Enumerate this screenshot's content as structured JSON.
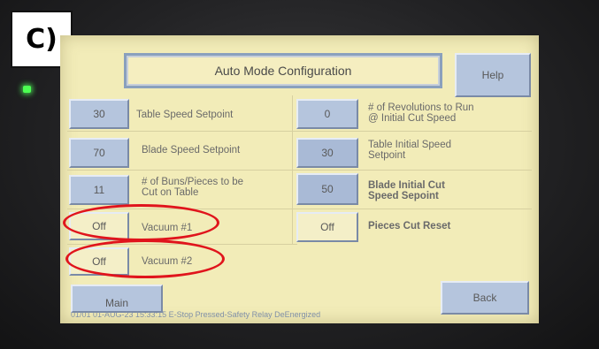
{
  "figure_label": "C)",
  "screen": {
    "title": "Auto Mode Configuration",
    "help_label": "Help",
    "left_rows": [
      {
        "value": "30",
        "label": "Table Speed Setpoint"
      },
      {
        "value": "70",
        "label": "Blade Speed Setpoint"
      },
      {
        "value": "11",
        "label_line1": "# of Buns/Pieces to be",
        "label_line2": "Cut on Table"
      },
      {
        "value": "Off",
        "label": "Vacuum #1"
      },
      {
        "value": "Off",
        "label": "Vacuum #2"
      }
    ],
    "right_rows": [
      {
        "value": "0",
        "label_line1": "# of Revolutions to Run",
        "label_line2": "@ Initial Cut Speed"
      },
      {
        "value": "30",
        "label_line1": "Table Initial Speed",
        "label_line2": "Setpoint"
      },
      {
        "value": "50",
        "label_line1": "Blade Initial Cut",
        "label_line2": "Speed Sepoint"
      },
      {
        "value": "Off",
        "label": "Pieces Cut Reset"
      }
    ],
    "main_label": "Main",
    "back_label": "Back",
    "status_text": "01/01 01-AUG-23 15:33:15 E-Stop Pressed-Safety Relay DeEnergized"
  },
  "colors": {
    "screen_bg": "#f2ecb8",
    "button": "#b5c5dd",
    "highlight_ring": "#e0141c",
    "status_led": "#4cff52"
  }
}
